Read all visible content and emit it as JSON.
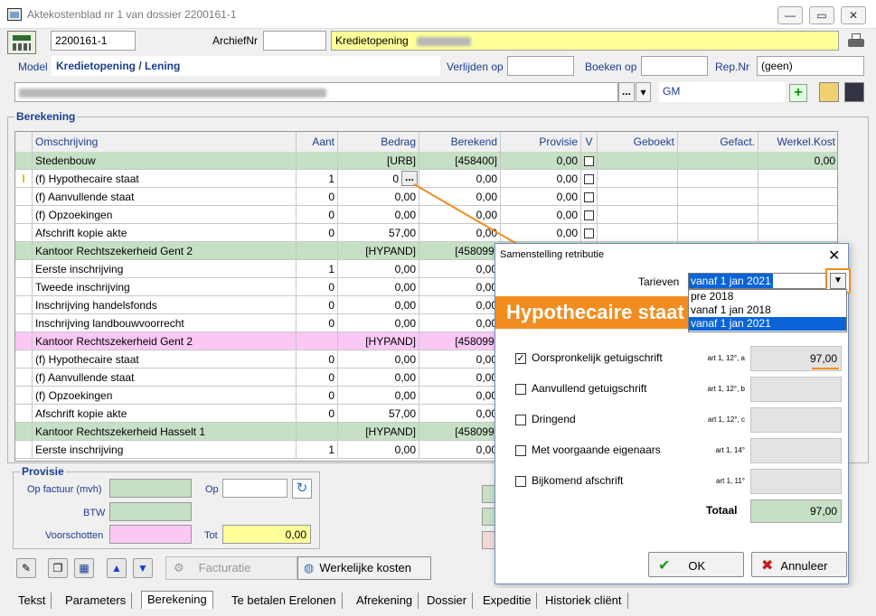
{
  "window": {
    "title": "Aktekostenblad nr 1 van dossier 2200161-1",
    "buttons": {
      "min": "—",
      "max": "▭",
      "close": "✕"
    }
  },
  "header": {
    "dossier_nr": "2200161-1",
    "archief_label": "ArchiefNr",
    "archief_value": "",
    "dossier_name": "Kredietopening",
    "model_label": "Model",
    "model_value": "Kredietopening / Lening",
    "verlijden_label": "Verlijden op",
    "verlijden_value": "",
    "boeken_label": "Boeken op",
    "boeken_value": "",
    "rep_label": "Rep.Nr",
    "rep_value": "(geen)",
    "ellipsis": "...",
    "dropdown_arrow": "▾",
    "gm_value": "GM",
    "plus": "+"
  },
  "berekening": {
    "title": "Berekening",
    "columns": [
      "Omschrijving",
      "Aant",
      "Bedrag",
      "Berekend",
      "Provisie",
      "V",
      "Geboekt",
      "Gefact.",
      "Werkel.Kost"
    ],
    "rows": [
      {
        "type": "group",
        "desc": "Stedenbouw",
        "bedrag": "[URB]",
        "berekend": "[458400]",
        "provisie": "0,00",
        "werkel": "0,00"
      },
      {
        "type": "item",
        "marker": "I",
        "desc": "(f) Hypothecaire staat",
        "aant": "1",
        "bedrag": "0",
        "bedrag_btn": "...",
        "berekend": "0,00",
        "provisie": "0,00"
      },
      {
        "type": "item",
        "desc": "(f) Aanvullende staat",
        "aant": "0",
        "bedrag": "0,00",
        "berekend": "0,00",
        "provisie": "0,00"
      },
      {
        "type": "item",
        "desc": "(f) Opzoekingen",
        "aant": "0",
        "bedrag": "0,00",
        "berekend": "0,00",
        "provisie": "0,00"
      },
      {
        "type": "item",
        "desc": "Afschrift kopie akte",
        "aant": "0",
        "bedrag": "57,00",
        "berekend": "0,00",
        "provisie": "0,00"
      },
      {
        "type": "group",
        "desc": "Kantoor Rechtszekerheid Gent 2",
        "bedrag": "[HYPAND]",
        "berekend": "[458099]"
      },
      {
        "type": "item",
        "desc": "Eerste inschrijving",
        "aant": "1",
        "bedrag": "0,00",
        "berekend": "0,00"
      },
      {
        "type": "item",
        "desc": "Tweede inschrijving",
        "aant": "0",
        "bedrag": "0,00",
        "berekend": "0,00"
      },
      {
        "type": "item",
        "desc": "Inschrijving handelsfonds",
        "aant": "0",
        "bedrag": "0,00",
        "berekend": "0,00"
      },
      {
        "type": "item",
        "desc": "Inschrijving landbouwvoorrecht",
        "aant": "0",
        "bedrag": "0,00",
        "berekend": "0,00"
      },
      {
        "type": "pink",
        "desc": "Kantoor Rechtszekerheid Gent 2",
        "bedrag": "[HYPAND]",
        "berekend": "[458099]"
      },
      {
        "type": "item",
        "desc": "(f) Hypothecaire staat",
        "aant": "0",
        "bedrag": "0,00",
        "berekend": "0,00"
      },
      {
        "type": "item",
        "desc": "(f) Aanvullende staat",
        "aant": "0",
        "bedrag": "0,00",
        "berekend": "0,00"
      },
      {
        "type": "item",
        "desc": "(f) Opzoekingen",
        "aant": "0",
        "bedrag": "0,00",
        "berekend": "0,00"
      },
      {
        "type": "item",
        "desc": "Afschrift kopie akte",
        "aant": "0",
        "bedrag": "57,00",
        "berekend": "0,00"
      },
      {
        "type": "group",
        "desc": "Kantoor Rechtszekerheid Hasselt 1",
        "bedrag": "[HYPAND]",
        "berekend": "[458099]"
      },
      {
        "type": "item",
        "desc": "Eerste inschrijving",
        "aant": "1",
        "bedrag": "0,00",
        "berekend": "0,00"
      }
    ]
  },
  "provisie": {
    "title": "Provisie",
    "op_factuur_label": "Op factuur (mvh)",
    "op_label": "Op",
    "btw_label": "BTW",
    "voorschotten_label": "Voorschotten",
    "tot_label": "Tot",
    "tot_value": "0,00"
  },
  "toolbar": {
    "facturatie": "Facturatie",
    "werkelijke_kosten": "Werkelijke kosten"
  },
  "dialog": {
    "title": "Samenstelling retributie",
    "close": "✕",
    "tarieven_label": "Tarieven",
    "tarieven_selected": "vanaf 1 jan 2021",
    "tarieven_options": [
      "pre 2018",
      "vanaf 1 jan 2018",
      "vanaf 1 jan 2021"
    ],
    "banner": "Hypothecaire staat",
    "items": [
      {
        "label": "Oorspronkelijk getuigschrift",
        "checked": true,
        "art": "art 1, 12°, a",
        "value": "97,00"
      },
      {
        "label": "Aanvullend getuigschrift",
        "checked": false,
        "art": "art 1, 12°, b",
        "value": ""
      },
      {
        "label": "Dringend",
        "checked": false,
        "art": "art 1, 12°, c",
        "value": ""
      },
      {
        "label": "Met voorgaande eigenaars",
        "checked": false,
        "art": "art 1, 14°",
        "value": ""
      },
      {
        "label": "Bijkomend afschrift",
        "checked": false,
        "art": "art 1, 11°",
        "value": ""
      }
    ],
    "totaal_label": "Totaal",
    "totaal_value": "97,00",
    "ok_label": "OK",
    "annuleer_label": "Annuleer"
  },
  "tabs": [
    "Tekst",
    "Parameters",
    "Berekening",
    "Te betalen Erelonen",
    "Afrekening",
    "Dossier",
    "Expeditie",
    "Historiek cliënt"
  ],
  "colors": {
    "accent_orange": "#f28c1f",
    "group_green": "#c6e0c6",
    "pink": "#fbc8f5",
    "yellow": "#ffff99"
  }
}
